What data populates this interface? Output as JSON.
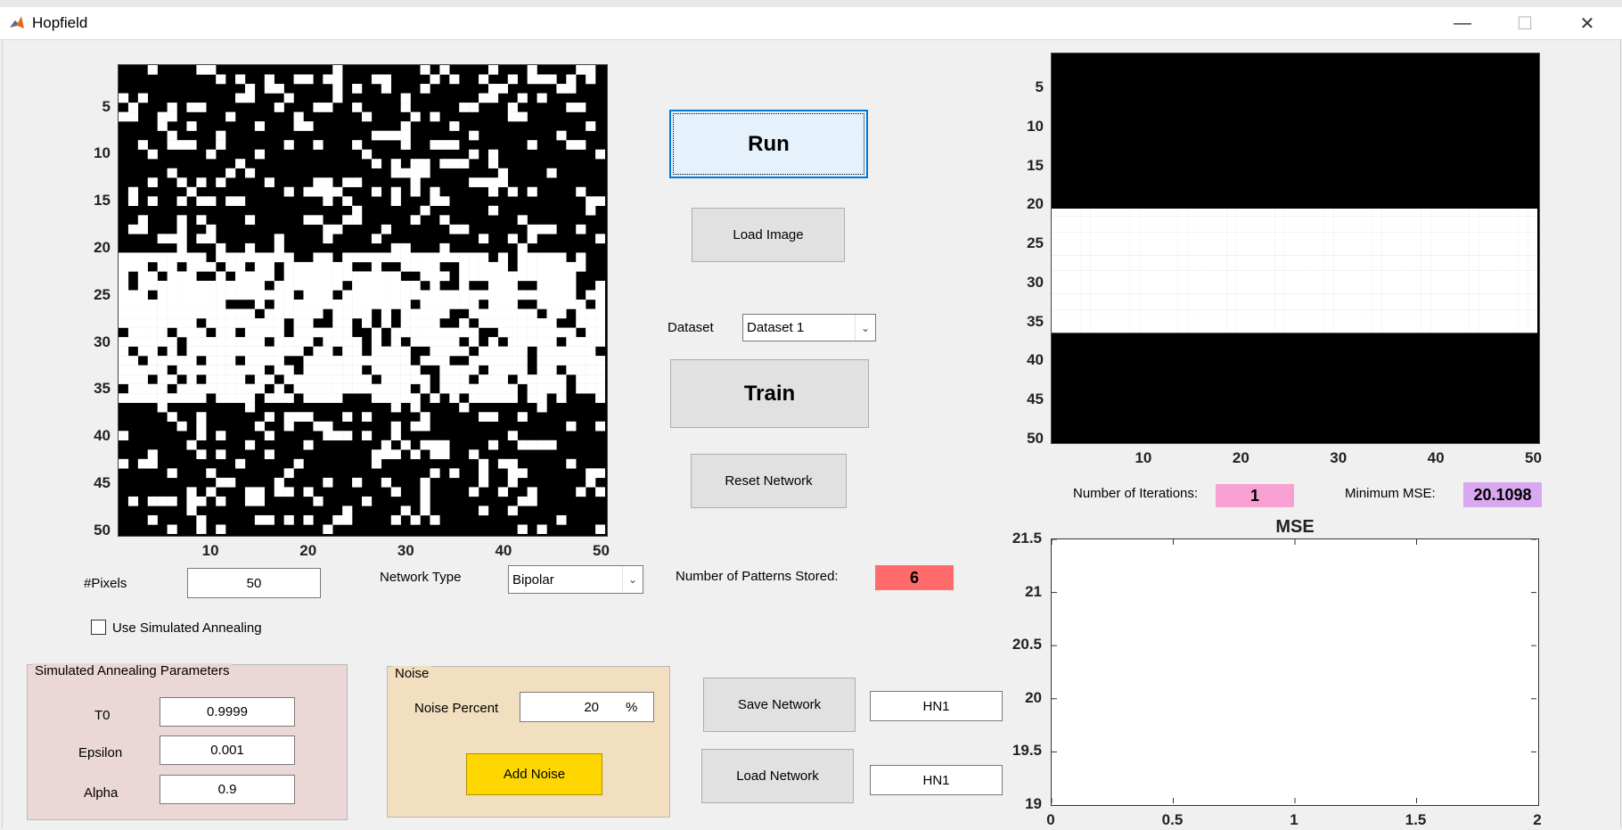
{
  "window": {
    "title": "Hopfield"
  },
  "controls": {
    "pixels_label": "#Pixels",
    "pixels_value": "50",
    "network_type_label": "Network Type",
    "network_type_value": "Bipolar",
    "use_sa_label": "Use Simulated Annealing",
    "use_sa_checked": false,
    "run_label": "Run",
    "load_image_label": "Load Image",
    "dataset_label": "Dataset",
    "dataset_value": "Dataset 1",
    "train_label": "Train",
    "reset_label": "Reset Network",
    "patterns_label": "Number of Patterns Stored:",
    "patterns_value": "6",
    "save_network_label": "Save Network",
    "save_network_name": "HN1",
    "load_network_label": "Load Network",
    "load_network_name": "HN1",
    "iterations_label": "Number of Iterations:",
    "iterations_value": "1",
    "min_mse_label": "Minimum MSE:",
    "min_mse_value": "20.1098"
  },
  "sa_panel": {
    "title": "Simulated Annealing Parameters",
    "t0_label": "T0",
    "t0_value": "0.9999",
    "epsilon_label": "Epsilon",
    "epsilon_value": "0.001",
    "alpha_label": "Alpha",
    "alpha_value": "0.9"
  },
  "noise_panel": {
    "title": "Noise",
    "percent_label": "Noise Percent",
    "percent_value": "20",
    "percent_unit": "%",
    "add_noise_label": "Add Noise"
  },
  "colors": {
    "patterns_badge": "#ff6b6b",
    "iterations_badge": "#f7a1d3",
    "min_mse_badge": "#d8a8f0",
    "sa_panel_bg": "#ecd7d7",
    "noise_panel_bg": "#f2dfbf",
    "add_noise_bg": "#ffd700"
  },
  "chart_data": [
    {
      "type": "heatmap",
      "name": "noisy-input-image",
      "grid": [
        50,
        50
      ],
      "white_band_rows": [
        21,
        36
      ],
      "noise_percent": 20,
      "xticks": [
        "10",
        "20",
        "30",
        "40",
        "50"
      ],
      "yticks": [
        "5",
        "10",
        "15",
        "20",
        "25",
        "30",
        "35",
        "40",
        "45",
        "50"
      ]
    },
    {
      "type": "heatmap",
      "name": "recalled-output-image",
      "grid": [
        50,
        50
      ],
      "white_band_rows": [
        21,
        36
      ],
      "xticks": [
        "10",
        "20",
        "30",
        "40",
        "50"
      ],
      "yticks": [
        "5",
        "10",
        "15",
        "20",
        "25",
        "30",
        "35",
        "40",
        "45",
        "50"
      ]
    },
    {
      "type": "line",
      "title": "MSE",
      "x": [],
      "y": [],
      "xlim": [
        0,
        2
      ],
      "ylim": [
        19,
        21.5
      ],
      "xticks": [
        "0",
        "0.5",
        "1",
        "1.5",
        "2"
      ],
      "yticks": [
        "19",
        "19.5",
        "20",
        "20.5",
        "21",
        "21.5"
      ]
    }
  ]
}
